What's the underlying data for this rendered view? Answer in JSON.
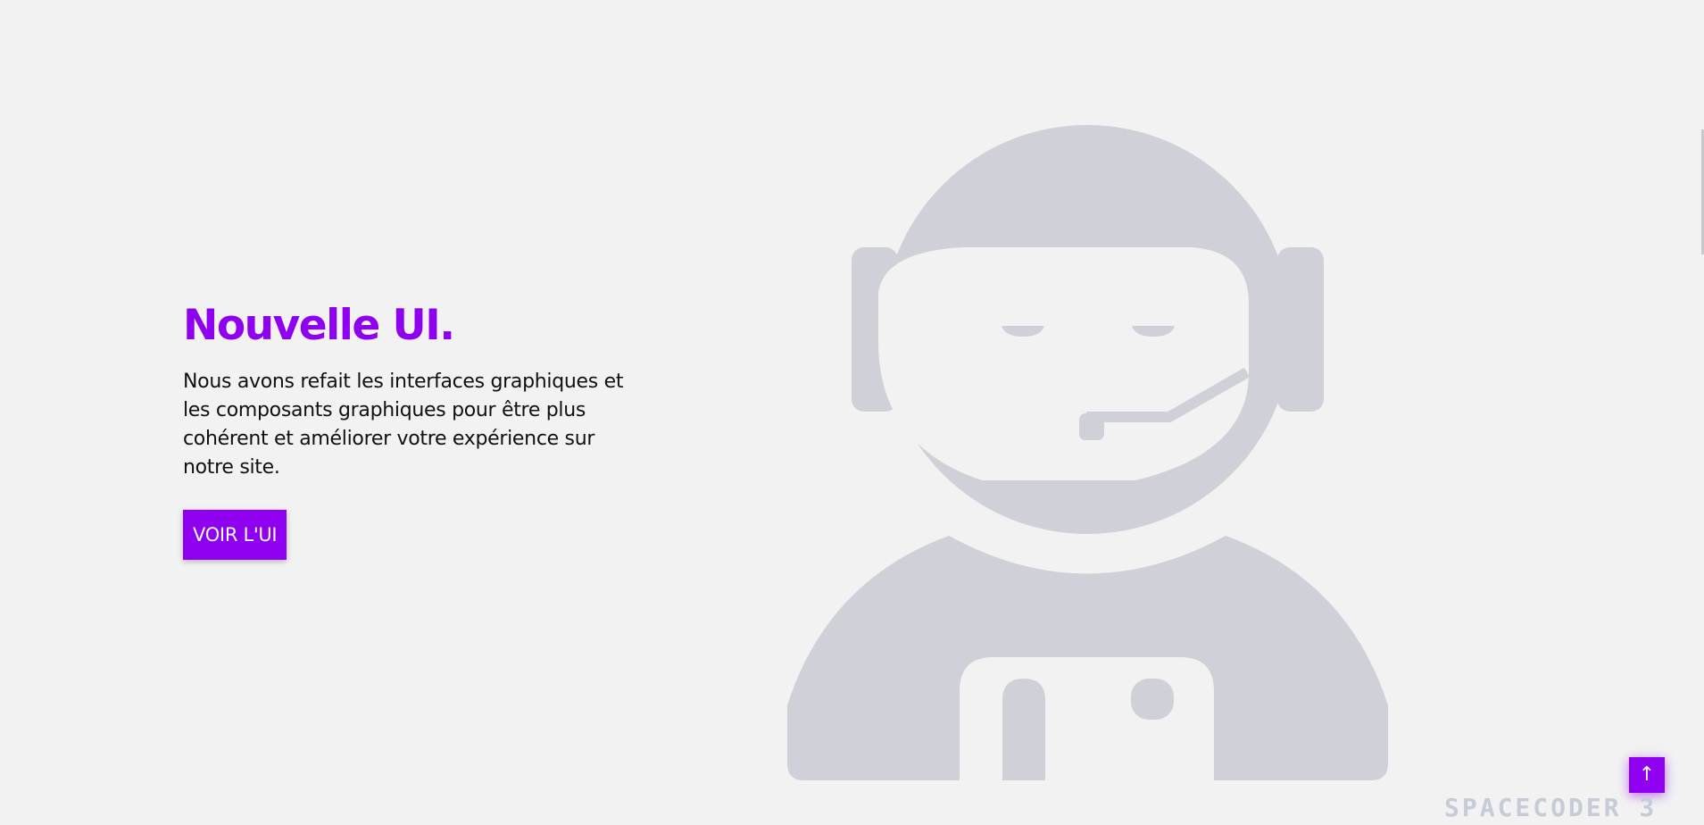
{
  "hero": {
    "title": "Nouvelle UI.",
    "description": "Nous avons refait les interfaces graphiques et les composants graphiques pour être plus cohérent et améliorer votre expérience sur notre site.",
    "cta_label": "VOIR L'UI"
  },
  "illustration": {
    "icon": "astronaut-support-icon",
    "color": "#d0d0d8"
  },
  "scroll_top": {
    "label": "↑"
  },
  "brand": {
    "watermark": "SPACECODER 3"
  },
  "colors": {
    "accent": "#9000f0",
    "background": "#f2f2f2"
  }
}
